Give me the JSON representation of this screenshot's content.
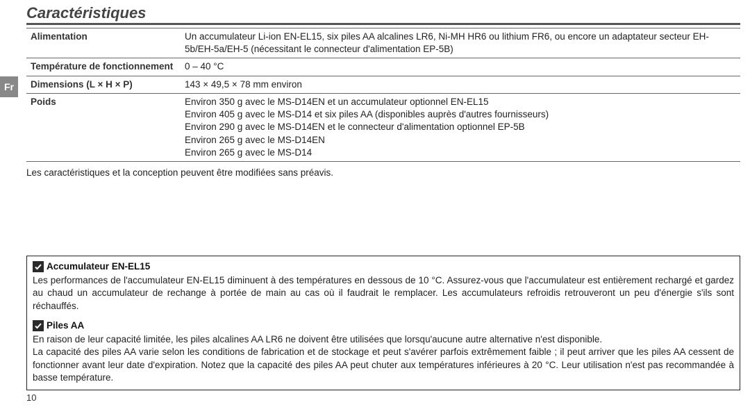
{
  "lang_tab": "Fr",
  "section_title": "Caractéristiques",
  "spec_rows": [
    {
      "label": "Alimentation",
      "value": "Un accumulateur Li-ion EN-EL15, six piles AA alcalines LR6, Ni-MH HR6 ou lithium FR6, ou encore un adaptateur secteur EH-5b/EH-5a/EH-5 (nécessitant le connecteur d'alimentation EP-5B)"
    },
    {
      "label": "Température de fonctionnement",
      "value": "0 – 40 °C"
    },
    {
      "label": "Dimensions (L × H × P)",
      "value": "143 × 49,5 × 78 mm environ"
    },
    {
      "label": "Poids",
      "value": "Environ 350 g avec le MS-D14EN et un accumulateur optionnel EN-EL15\nEnviron 405 g avec le MS-D14 et six piles AA (disponibles auprès d'autres fournisseurs)\nEnviron 290 g avec le MS-D14EN et le connecteur d'alimentation optionnel EP-5B\nEnviron 265 g avec le MS-D14EN\nEnviron 265 g avec le MS-D14"
    }
  ],
  "footnote": "Les caractéristiques et la conception peuvent être modifiées sans préavis.",
  "notes": [
    {
      "title": "Accumulateur EN-EL15",
      "body": "Les performances de l'accumulateur EN-EL15 diminuent à des températures en dessous de 10 °C. Assurez-vous que l'accumulateur est entièrement rechargé et gardez au chaud un accumulateur de rechange à portée de main au cas où il faudrait le remplacer. Les accumulateurs refroidis retrouveront un peu d'énergie s'ils sont réchauffés."
    },
    {
      "title": "Piles AA",
      "body": "En raison de leur capacité limitée, les piles alcalines AA LR6 ne doivent être utilisées que lorsqu'aucune autre alternative n'est disponible.\nLa capacité des piles AA varie selon les conditions de fabrication et de stockage et peut s'avérer parfois extrêmement faible ; il peut arriver que les piles AA cessent de fonctionner avant leur date d'expiration. Notez que la capacité des piles AA peut chuter aux températures inférieures à 20 °C. Leur utilisation n'est pas recommandée à basse température."
    }
  ],
  "page_number": "10"
}
